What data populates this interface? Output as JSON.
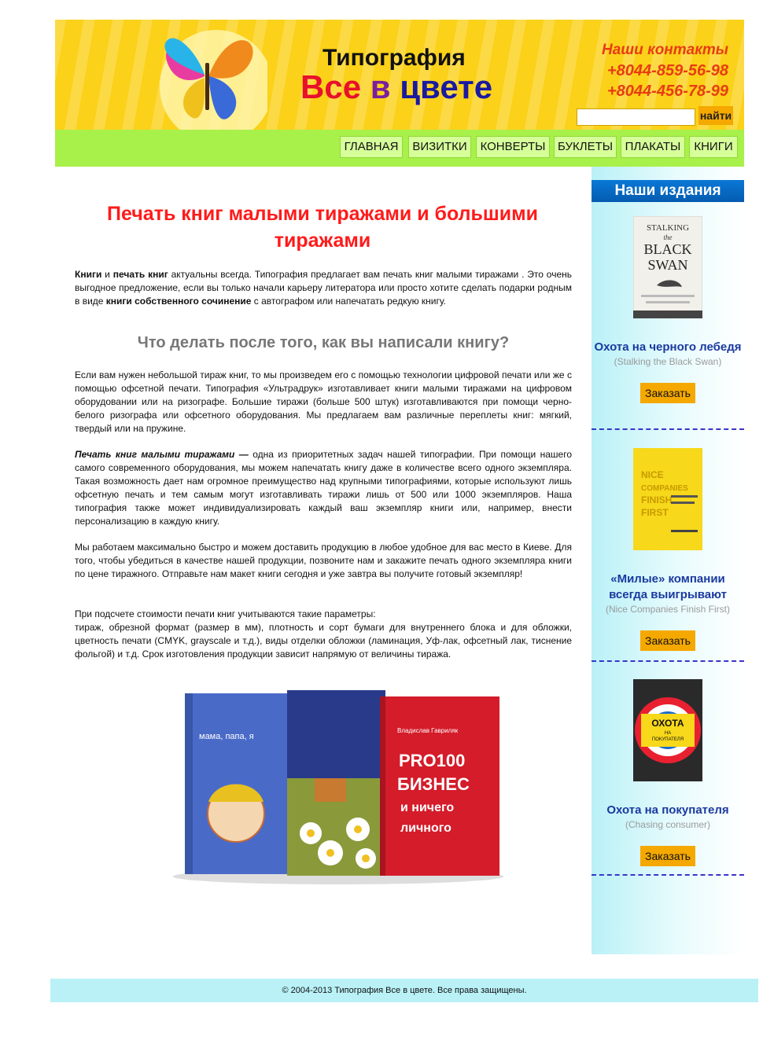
{
  "header": {
    "title_line1": "Типография",
    "title_all": "Все",
    "title_v": "в",
    "title_color": "цвете",
    "contacts_label": "Наши контакты",
    "phone1": "+8044-859-56-98",
    "phone2": "+8044-456-78-99",
    "search_placeholder": "",
    "search_button": "найти"
  },
  "nav": [
    "ГЛАВНАЯ",
    "ВИЗИТКИ",
    "КОНВЕРТЫ",
    "БУКЛЕТЫ",
    "ПЛАКАТЫ",
    "КНИГИ"
  ],
  "main": {
    "title": "Печать книг малыми тиражами и большими тиражами",
    "intro_b1": "Книги",
    "intro_t1": " и ",
    "intro_b2": "печать книг",
    "intro_t2": " актуальны всегда. Типография предлагает вам печать книг малыми тиражами . Это очень выгодное предложение, если вы только начали карьеру литератора или просто хотите сделать подарки родным в виде ",
    "intro_b3": "книги собственного сочинение",
    "intro_t3": " с автографом или напечатать редкую книгу.",
    "subheading": "Что делать после того, как вы написали книгу?",
    "para2": "Если вам нужен небольшой тираж книг, то мы произведем его с помощью технологии цифровой печати или же с помощью офсетной печати. Типография «Ультрадрук» изготавливает книги малыми тиражами на цифровом оборудовании или на ризографе. Большие тиражи (больше 500 штук) изготавливаются при помощи черно-белого ризографа или офсетного оборудования. Мы предлагаем вам различные переплеты книг: мягкий, твердый или на пружине.",
    "para3_bi": "Печать книг малыми тиражами —",
    "para3_t": " одна из приоритетных задач нашей типографии. При помощи нашего самого современного оборудования, мы можем напечатать книгу даже в количестве всего одного экземпляра. Такая возможность дает нам огромное преимущество над крупными типографиями, которые используют лишь офсетную печать и тем самым могут изготавливать тиражи лишь от 500 или 1000 экземпляров. Наша типография также может индивидуализировать каждый ваш экземпляр книги или, например, внести персонализацию в каждую книгу.",
    "para4": "Мы работаем максимально быстро и можем доставить продукцию в любое удобное для вас место в Киеве. Для того, чтобы убедиться в качестве нашей продукции, позвоните нам и закажите печать одного экземпляра книги по цене тиражного. Отправьте нам макет книги сегодня и уже завтра вы получите готовый экземпляр!",
    "para5_l1": "При подсчете стоимости печати книг учитываются такие параметры:",
    "para5_l2": "тираж, обрезной формат (размер в мм), плотность и сорт бумаги для внутреннего блока и для обложки, цветность печати (CMYK, grayscale и т.д.), виды отделки обложки (ламинация, Уф-лак, офсетный лак, тиснение фольгой) и т.д. Срок изготовления продукции зависит напрямую от величины тиража.",
    "img_book1": "мама, папа, я",
    "img_book3_l1": "PRO100",
    "img_book3_l2": "БИЗНЕС",
    "img_book3_l3": "и ничего",
    "img_book3_l4": "личного",
    "img_book3_author": "Владислав Гавриляк"
  },
  "sidebar": {
    "heading": "Наши издания",
    "order_label": "Заказать",
    "books": [
      {
        "title": "Охота на черного лебедя",
        "original": "(Stalking the Black Swan)",
        "cover_l1": "STALKING",
        "cover_l2": "the",
        "cover_l3": "BLACK",
        "cover_l4": "SWAN"
      },
      {
        "title": "«Милые» компании всегда выигрывают",
        "original": "(Nice Companies Finish First)",
        "cover_l1": "NICE",
        "cover_l2": "COMPANIES",
        "cover_l3": "FINISH",
        "cover_l4": "FIRST"
      },
      {
        "title": "Охота на покупателя",
        "original": "(Chasing consumer)",
        "cover_l1": "ОХОТА",
        "cover_l2": "НА",
        "cover_l3": "ПОКУПАТЕЛЯ",
        "cover_l4": ""
      }
    ]
  },
  "footer": {
    "text": "© 2004-2013 Типография Все в цвете. Все права защищены."
  },
  "colors": {
    "header_bg": "#fbd21c",
    "nav_bg": "#a8f04a",
    "title_red": "#ff1a1a",
    "button_orange": "#f5a800",
    "sidebar_head": "#0a78d6",
    "footer_bg": "#b9f1f7"
  }
}
